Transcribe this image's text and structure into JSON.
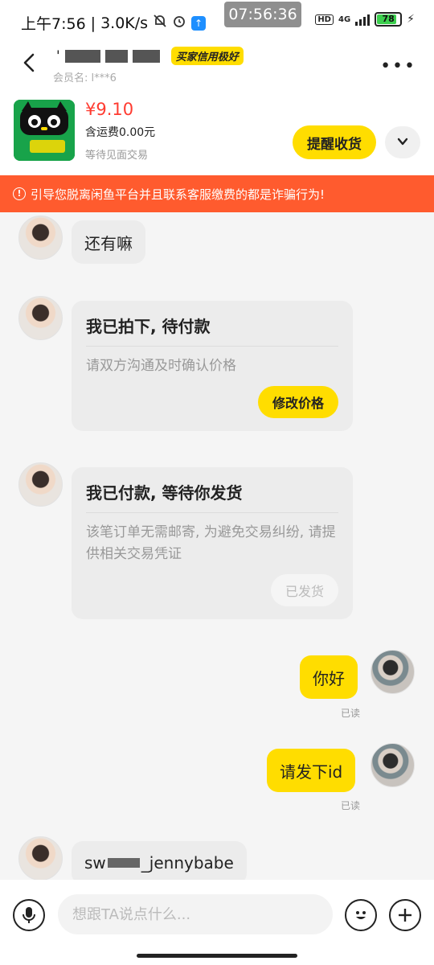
{
  "status_bar": {
    "time": "上午7:56",
    "net_speed": "3.0K/s",
    "clock_overlay": "07:56:36",
    "hd": "HD",
    "network": "4G",
    "battery": "78",
    "battery_level": 0.78
  },
  "header": {
    "seller_name_visible": "'",
    "credit_badge": "买家信用极好",
    "member": "会员名: l***6"
  },
  "product": {
    "price": "¥9.10",
    "shipping": "含运费0.00元",
    "status": "等待见面交易",
    "remind_label": "提醒收货"
  },
  "warning": {
    "text": "引导您脱离闲鱼平台并且联系客服缴费的都是诈骗行为!"
  },
  "messages": [
    {
      "side": "left",
      "type": "text",
      "text": "还有嘛"
    },
    {
      "side": "left",
      "type": "card",
      "title": "我已拍下, 待付款",
      "desc": "请双方沟通及时确认价格",
      "button": "修改价格"
    },
    {
      "side": "left",
      "type": "card",
      "title": "我已付款, 等待你发货",
      "desc": "该笔订单无需邮寄, 为避免交易纠纷, 请提供相关交易凭证",
      "button": "已发货"
    },
    {
      "side": "right",
      "type": "text",
      "text": "你好",
      "read": "已读"
    },
    {
      "side": "right",
      "type": "text",
      "text": "请发下id",
      "read": "已读"
    },
    {
      "side": "left",
      "type": "text",
      "text_start": "sw",
      "text_end": "_jennybabe"
    }
  ],
  "input": {
    "placeholder": "想跟TA说点什么..."
  },
  "colors": {
    "accent": "#ffdd00",
    "price": "#ff3b30",
    "warning": "#ff5b2e"
  }
}
